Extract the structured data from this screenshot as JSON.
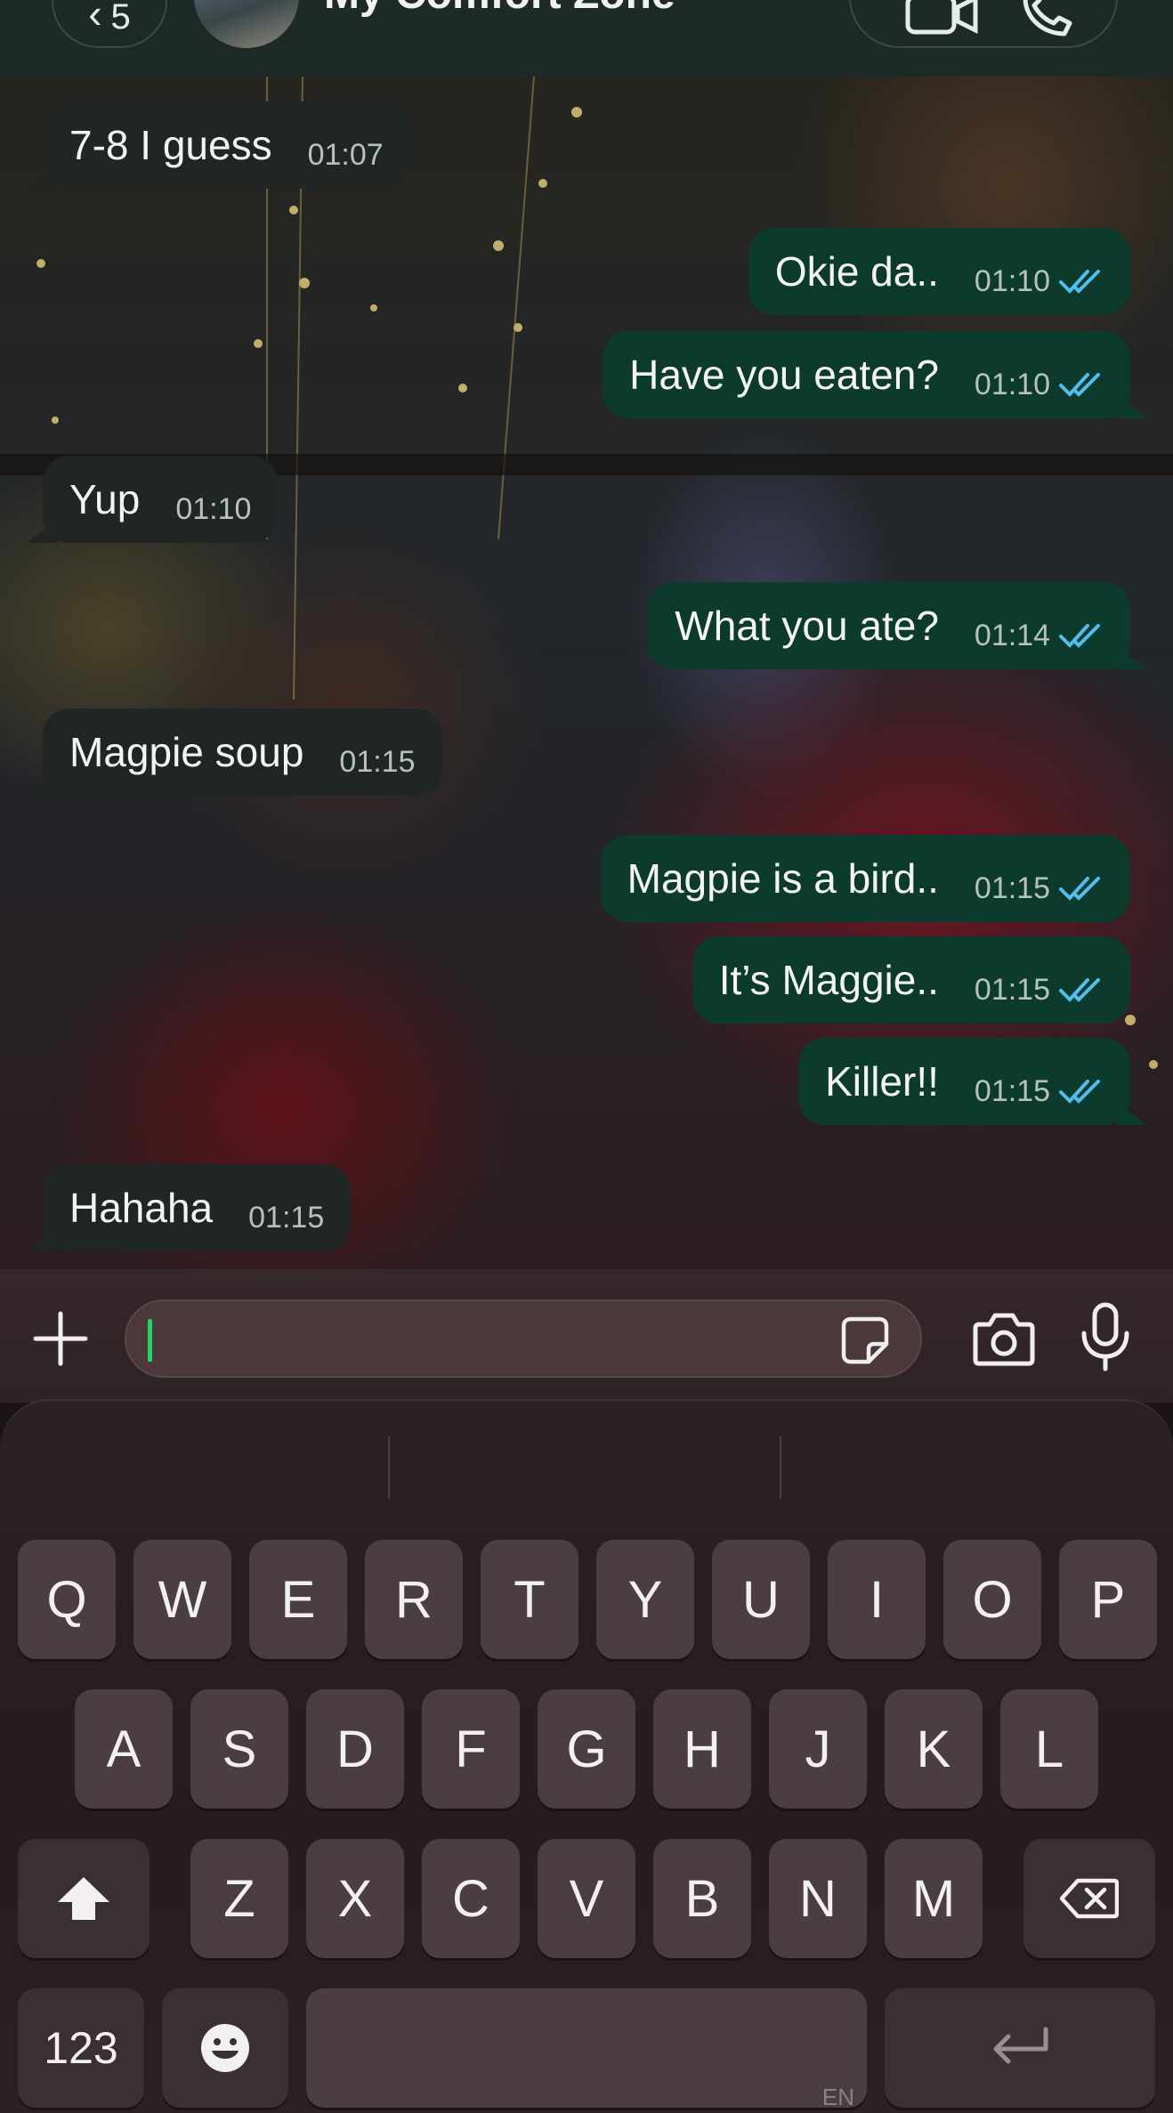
{
  "header": {
    "back_badge": "5",
    "chat_title": "My Comfort Zone"
  },
  "messages": [
    {
      "dir": "in",
      "text": "7-8 I guess",
      "time": "01:07"
    },
    {
      "dir": "out",
      "text": "Okie da..",
      "time": "01:10",
      "read": true
    },
    {
      "dir": "out",
      "text": "Have you eaten?",
      "time": "01:10",
      "read": true
    },
    {
      "dir": "in",
      "text": "Yup",
      "time": "01:10"
    },
    {
      "dir": "out",
      "text": "What you ate?",
      "time": "01:14",
      "read": true
    },
    {
      "dir": "in",
      "text": "Magpie soup",
      "time": "01:15"
    },
    {
      "dir": "out",
      "text": "Magpie is a bird..",
      "time": "01:15",
      "read": true
    },
    {
      "dir": "out",
      "text": "It’s Maggie..",
      "time": "01:15",
      "read": true
    },
    {
      "dir": "out",
      "text": "Killer!!",
      "time": "01:15",
      "read": true
    },
    {
      "dir": "in",
      "text": "Hahaha",
      "time": "01:15"
    }
  ],
  "input": {
    "value": ""
  },
  "keyboard": {
    "row1": [
      "Q",
      "W",
      "E",
      "R",
      "T",
      "Y",
      "U",
      "I",
      "O",
      "P"
    ],
    "row2": [
      "A",
      "S",
      "D",
      "F",
      "G",
      "H",
      "J",
      "K",
      "L"
    ],
    "row3": [
      "Z",
      "X",
      "C",
      "V",
      "B",
      "N",
      "M"
    ],
    "numbers_label": "123",
    "space_lang_label": "EN"
  },
  "colors": {
    "incoming_bubble": "#1f2623",
    "outgoing_bubble": "#0c3a2d",
    "read_ticks": "#53bdeb",
    "cursor": "#25d366"
  }
}
